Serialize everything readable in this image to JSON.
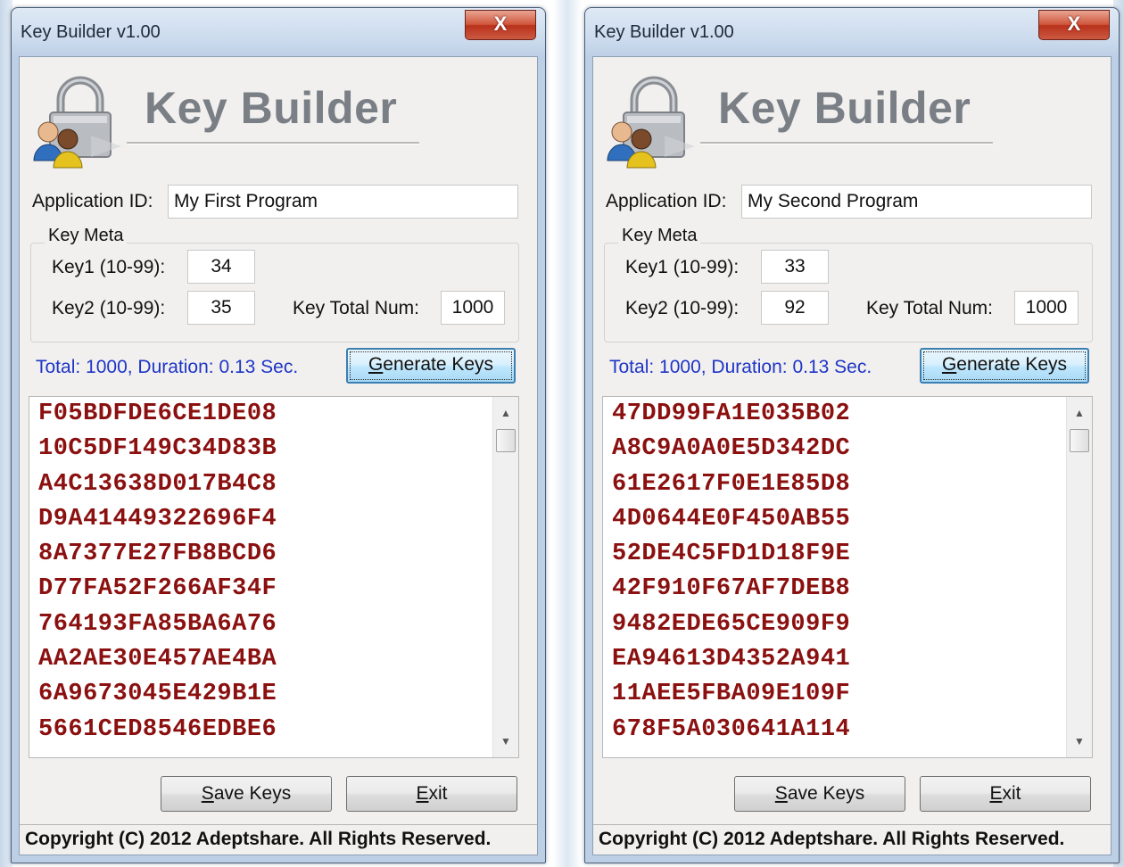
{
  "windows": [
    {
      "title": "Key Builder v1.00",
      "close_label": "X",
      "logo_title": "Key Builder",
      "app_id_label": "Application ID:",
      "app_id_value": "My First Program",
      "key_meta_label": "Key Meta",
      "key1_label": "Key1 (10-99):",
      "key1_value": "34",
      "key2_label": "Key2 (10-99):",
      "key2_value": "35",
      "key_total_label": "Key Total Num:",
      "key_total_value": "1000",
      "status": "Total: 1000, Duration: 0.13 Sec.",
      "generate_label": {
        "u": "G",
        "rest": "enerate Keys"
      },
      "keys": [
        "F05BDFDE6CE1DE08",
        "10C5DF149C34D83B",
        "A4C13638D017B4C8",
        "D9A41449322696F4",
        "8A7377E27FB8BCD6",
        "D77FA52F266AF34F",
        "764193FA85BA6A76",
        "AA2AE30E457AE4BA",
        "6A9673045E429B1E",
        "5661CED8546EDBE6"
      ],
      "save_label": {
        "u": "S",
        "rest": "ave Keys"
      },
      "exit_label": {
        "u": "E",
        "rest": "xit"
      },
      "copyright": "Copyright (C) 2012 Adeptshare. All Rights Reserved."
    },
    {
      "title": "Key Builder v1.00",
      "close_label": "X",
      "logo_title": "Key Builder",
      "app_id_label": "Application ID:",
      "app_id_value": "My Second Program",
      "key_meta_label": "Key Meta",
      "key1_label": "Key1 (10-99):",
      "key1_value": "33",
      "key2_label": "Key2 (10-99):",
      "key2_value": "92",
      "key_total_label": "Key Total Num:",
      "key_total_value": "1000",
      "status": "Total: 1000, Duration: 0.13 Sec.",
      "generate_label": {
        "u": "G",
        "rest": "enerate Keys"
      },
      "keys": [
        "47DD99FA1E035B02",
        "A8C9A0A0E5D342DC",
        "61E2617F0E1E85D8",
        "4D0644E0F450AB55",
        "52DE4C5FD1D18F9E",
        "42F910F67AF7DEB8",
        "9482EDE65CE909F9",
        "EA94613D4352A941",
        "11AEE5FBA09E109F",
        "678F5A030641A114"
      ],
      "save_label": {
        "u": "S",
        "rest": "ave Keys"
      },
      "exit_label": {
        "u": "E",
        "rest": "xit"
      },
      "copyright": "Copyright (C) 2012 Adeptshare. All Rights Reserved."
    }
  ]
}
